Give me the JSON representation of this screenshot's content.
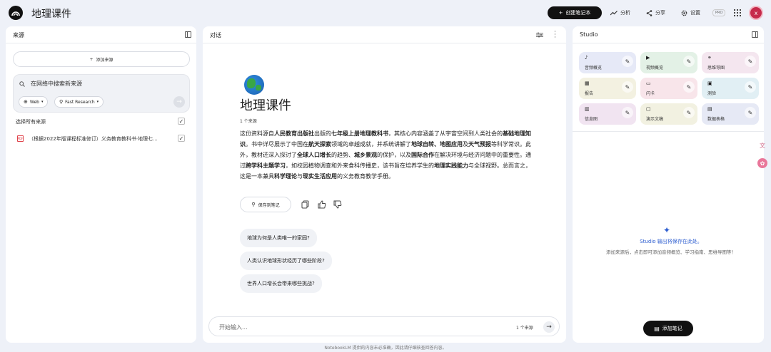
{
  "app": {
    "title": "地理课件",
    "avatar_initial": "x"
  },
  "header": {
    "create_label": "创建笔记本",
    "analyze_label": "分析",
    "share_label": "分享",
    "settings_label": "设置",
    "pro_badge": "PRO"
  },
  "sources": {
    "title": "来源",
    "add_label": "添加来源",
    "search_placeholder": "在网络中搜索新来源",
    "web_chip": "Web",
    "research_chip": "Fast Research",
    "select_all_label": "选择所有来源",
    "items": [
      {
        "label": "（根据2022年版课程标准修订）义务教育教科书·地理七...",
        "checked": true
      }
    ]
  },
  "chat": {
    "title": "对话",
    "doc_title": "地理课件",
    "source_count": "1 个来源",
    "summary_parts": [
      {
        "t": "这份资料源自",
        "b": false
      },
      {
        "t": "人民教育出版社",
        "b": true
      },
      {
        "t": "出版的",
        "b": false
      },
      {
        "t": "七年级上册地理教科书",
        "b": true
      },
      {
        "t": "，其核心内容涵盖了从宇宙空间到人类社会的",
        "b": false
      },
      {
        "t": "基础地理知识",
        "b": true
      },
      {
        "t": "。书中详尽展示了中国在",
        "b": false
      },
      {
        "t": "航天探索",
        "b": true
      },
      {
        "t": "领域的卓越成就，并系统讲解了",
        "b": false
      },
      {
        "t": "地球自转、地图应用",
        "b": true
      },
      {
        "t": "及",
        "b": false
      },
      {
        "t": "天气预报",
        "b": true
      },
      {
        "t": "等科学常识。此外，教材还深入探讨了",
        "b": false
      },
      {
        "t": "全球人口增长",
        "b": true
      },
      {
        "t": "的趋势、",
        "b": false
      },
      {
        "t": "城乡景观",
        "b": true
      },
      {
        "t": "的保护，以及",
        "b": false
      },
      {
        "t": "国际合作",
        "b": true
      },
      {
        "t": "在解决环境与经济问题中的重要性。通过",
        "b": false
      },
      {
        "t": "跨学科主题学习",
        "b": true
      },
      {
        "t": "，如校园植物调查和外来食科传播史，该书旨在培养学生的",
        "b": false
      },
      {
        "t": "地理实践能力",
        "b": true
      },
      {
        "t": "与全球视野。总而言之，这是一本兼具",
        "b": false
      },
      {
        "t": "科学理论",
        "b": true
      },
      {
        "t": "与",
        "b": false
      },
      {
        "t": "现实生活应用",
        "b": true
      },
      {
        "t": "的义务教育教学手册。",
        "b": false
      }
    ],
    "save_note_label": "保存到笔记",
    "suggestions": [
      "地球为何是人类唯一的家园?",
      "人类认识地球形状经历了哪些阶段?",
      "世界人口增长会带来哪些挑战?"
    ],
    "input_placeholder": "开始输入...",
    "input_source_count": "1 个来源"
  },
  "studio": {
    "title": "Studio",
    "tiles": [
      {
        "label": "音频概览",
        "icon": "audio-icon",
        "color": "#e6e9f7"
      },
      {
        "label": "视频概览",
        "icon": "video-icon",
        "color": "#e3f1e6"
      },
      {
        "label": "思维导图",
        "icon": "mindmap-icon",
        "color": "#f4e6ef"
      },
      {
        "label": "报告",
        "icon": "report-icon",
        "color": "#f3f1e1"
      },
      {
        "label": "闪卡",
        "icon": "flashcard-icon",
        "color": "#f8e5ea"
      },
      {
        "label": "测验",
        "icon": "quiz-icon",
        "color": "#e1eff4"
      },
      {
        "label": "信息图",
        "icon": "infographic-icon",
        "color": "#f1e4f1"
      },
      {
        "label": "演示文稿",
        "icon": "slides-icon",
        "color": "#f2f1e1"
      },
      {
        "label": "数据表格",
        "icon": "table-icon",
        "color": "#e6e9f5"
      }
    ],
    "empty_title": "Studio 输出将保存在此处。",
    "empty_desc": "添加来源后，点击即可添加音频概览、学习指南、思维导图等！",
    "add_note_label": "添加笔记"
  },
  "footer": {
    "disclaimer": "NotebookLM 提供的内容未必准确，因此请仔细核查回答内容。"
  }
}
